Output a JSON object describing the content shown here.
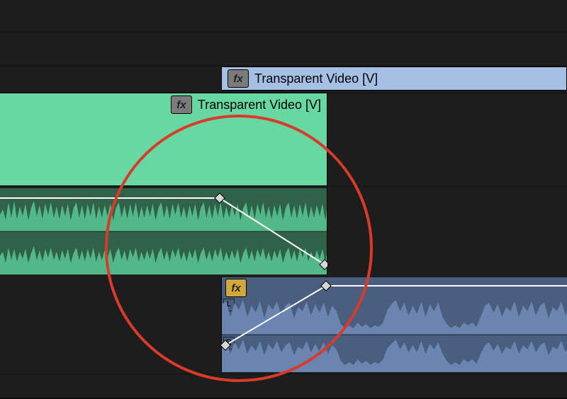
{
  "tracks": {
    "v2_clip_label": "Transparent Video [V]",
    "v1_clip_label": "Transparent Video [V]",
    "a2_channel_tags": {
      "left": "L",
      "right": "R"
    },
    "fx_badge_text": "fx"
  },
  "colors": {
    "clip_green": "#67d8a1",
    "clip_blue": "#809cc6",
    "annotation_red": "#d93a2a"
  },
  "keyframes": {
    "a1_clip": {
      "description": "Fade-out on outgoing green audio clip",
      "points": [
        {
          "x_pct": 0,
          "level": 1.0
        },
        {
          "x_pct": 67,
          "level": 1.0
        },
        {
          "x_pct": 100,
          "level": 0.0
        }
      ]
    },
    "a2_clip": {
      "description": "Fade-in on incoming blue audio clip",
      "points": [
        {
          "x_pct": 0,
          "level": 0.0
        },
        {
          "x_pct": 30,
          "level": 1.0
        },
        {
          "x_pct": 100,
          "level": 1.0
        }
      ]
    }
  },
  "annotation": {
    "shape": "circle",
    "purpose": "Highlights the audio crossfade region"
  }
}
